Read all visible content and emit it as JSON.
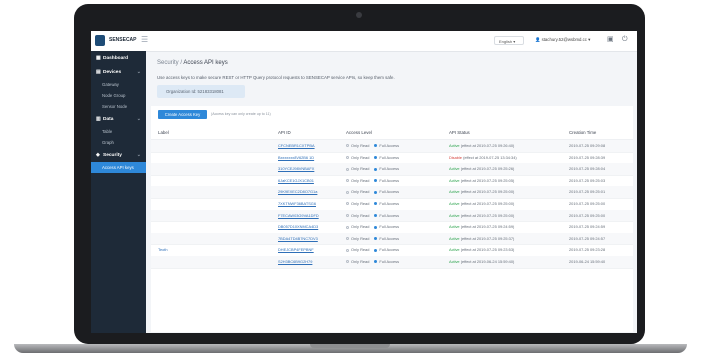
{
  "brand": {
    "name": "SENSECAP"
  },
  "topbar": {
    "language": "English",
    "user": "stachury.52@wsbmd.cc"
  },
  "sidebar": {
    "items": [
      {
        "label": "Dashboard",
        "type": "group"
      },
      {
        "label": "Devices",
        "type": "group"
      },
      {
        "label": "Gateway",
        "type": "sub"
      },
      {
        "label": "Node Group",
        "type": "sub"
      },
      {
        "label": "Sensor Node",
        "type": "sub"
      },
      {
        "label": "Data",
        "type": "group"
      },
      {
        "label": "Table",
        "type": "sub"
      },
      {
        "label": "Graph",
        "type": "sub"
      },
      {
        "label": "Security",
        "type": "group"
      },
      {
        "label": "Access API keys",
        "type": "sub",
        "active": true
      }
    ]
  },
  "page": {
    "breadcrumb_parent": "Security",
    "breadcrumb_sep": " / ",
    "breadcrumb_current": "Access API keys",
    "description": "Use access keys to make secure REST or HTTP Query protocol requests to SENSECAP service APIs, so keep them safe.",
    "organization": "Organization Id: 52183318081"
  },
  "toolbar": {
    "create_label": "Create Access Key",
    "hint": "(Access key can only create up to 11)"
  },
  "table": {
    "columns": [
      "Label",
      "API ID",
      "Access Level",
      "API Status",
      "Creation Time"
    ],
    "access_options": [
      "Only Read",
      "Full Access"
    ],
    "rows": [
      {
        "label": "",
        "api_id": "CFCNEBR1CXTPBA",
        "status": "Active",
        "effect": "(effect at 2019-07-25 09:26:40)",
        "created": "2019-07-25 09:29:08"
      },
      {
        "label": "",
        "api_id": "Bxxxxxxx8V62B6 1D",
        "status": "Disable",
        "effect": "(effect at 2019-07-25 13:34:34)",
        "created": "2019-07-25 09:28:39"
      },
      {
        "label": "",
        "api_id": "310YCEJ98VNBAFX",
        "status": "Active",
        "effect": "(effect at 2019-07-25 09:25:26)",
        "created": "2019-07-25 09:28:04"
      },
      {
        "label": "",
        "api_id": "6JaKCE1GJX1CB01",
        "status": "Active",
        "effect": "(effect at 2019-07-25 09:25:05)",
        "created": "2019-07-25 09:25:03"
      },
      {
        "label": "",
        "api_id": "29K9EXEC2D8O7G1a",
        "status": "Active",
        "effect": "(effect at 2019-07-25 09:25:00)",
        "created": "2019-07-25 09:25:01"
      },
      {
        "label": "",
        "api_id": "7XKTNWF36BATSG6",
        "status": "Active",
        "effect": "(effect at 2019-07-25 09:25:00)",
        "created": "2019-07-25 09:25:00"
      },
      {
        "label": "",
        "api_id": "F7ECAW03G9VA1DFD",
        "status": "Active",
        "effect": "(effect at 2019-07-25 09:25:00)",
        "created": "2019-07-25 09:25:00"
      },
      {
        "label": "",
        "api_id": "DB057D10XNMCA4D3",
        "status": "Active",
        "effect": "(effect at 2019-07-25 09:24:59)",
        "created": "2019-07-25 09:24:59"
      },
      {
        "label": "",
        "api_id": "7BDA4TD4B7NC7DV3",
        "status": "Active",
        "effect": "(effect at 2019-07-25 09:25:37)",
        "created": "2019-07-25 09:24:57"
      },
      {
        "label": "Teoth",
        "api_id": "DHEJCBP4FEPBNF",
        "status": "Active",
        "effect": "(effect at 2019-07-25 09:23:53)",
        "created": "2019-07-25 09:23:28"
      },
      {
        "label": "",
        "api_id": "S2H3BC6B9G2H79",
        "status": "Active",
        "effect": "(effect at 2019-06-24 15:59:40)",
        "created": "2019-06-24 15:59:40"
      }
    ]
  },
  "colors": {
    "sidebar_bg": "#1e2a38",
    "accent": "#2e88d9",
    "active_status": "#2ea44f",
    "disable_status": "#d43f3a"
  }
}
